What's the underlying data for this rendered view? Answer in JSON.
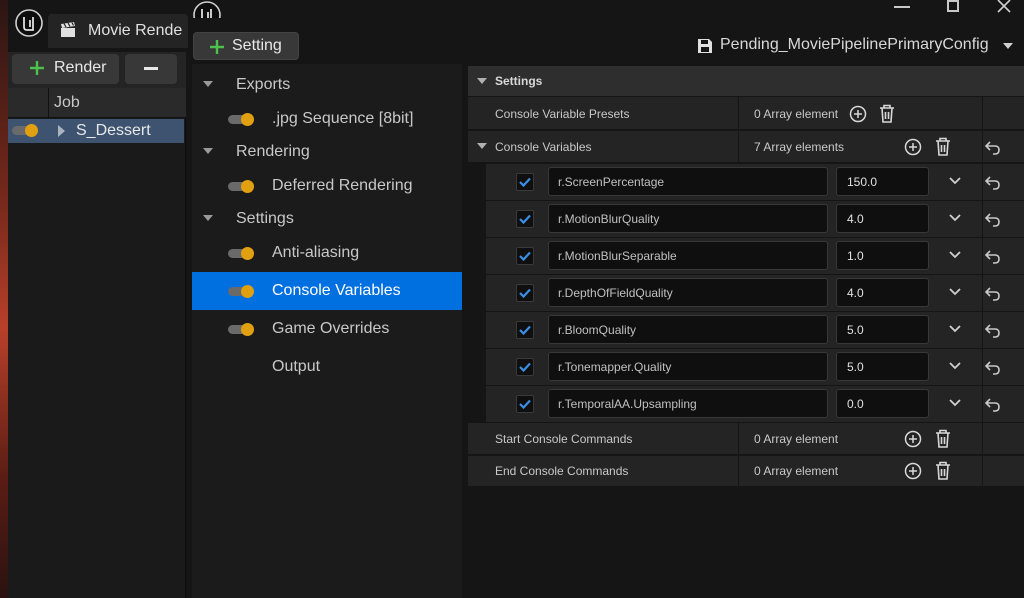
{
  "queue_window": {
    "tab_title": "Movie Rende",
    "toolbar": {
      "render_label": "Render"
    },
    "columns": {
      "job": "Job"
    },
    "jobs": [
      {
        "name": "S_Dessert",
        "enabled": true
      }
    ]
  },
  "config_window": {
    "toolbar": {
      "add_setting_label": "Setting",
      "preset_name": "Pending_MoviePipelinePrimaryConfig"
    },
    "settings_list": [
      {
        "kind": "category",
        "label": "Exports"
      },
      {
        "kind": "item",
        "label": ".jpg Sequence [8bit]",
        "toggle": true
      },
      {
        "kind": "category",
        "label": "Rendering"
      },
      {
        "kind": "item",
        "label": "Deferred Rendering",
        "toggle": true
      },
      {
        "kind": "category",
        "label": "Settings"
      },
      {
        "kind": "item",
        "label": "Anti-aliasing",
        "toggle": true
      },
      {
        "kind": "item",
        "label": "Console Variables",
        "toggle": true,
        "selected": true
      },
      {
        "kind": "item",
        "label": "Game Overrides",
        "toggle": true
      },
      {
        "kind": "item",
        "label": "Output",
        "toggle": false
      }
    ],
    "details": {
      "section_title": "Settings",
      "presets": {
        "label": "Console Variable Presets",
        "value": "0 Array element"
      },
      "console_variables": {
        "label": "Console Variables",
        "value": "7 Array elements",
        "items": [
          {
            "name": "r.ScreenPercentage",
            "value": "150.0",
            "enabled": true
          },
          {
            "name": "r.MotionBlurQuality",
            "value": "4.0",
            "enabled": true
          },
          {
            "name": "r.MotionBlurSeparable",
            "value": "1.0",
            "enabled": true
          },
          {
            "name": "r.DepthOfFieldQuality",
            "value": "4.0",
            "enabled": true
          },
          {
            "name": "r.BloomQuality",
            "value": "5.0",
            "enabled": true
          },
          {
            "name": "r.Tonemapper.Quality",
            "value": "5.0",
            "enabled": true
          },
          {
            "name": "r.TemporalAA.Upsampling",
            "value": "0.0",
            "enabled": true
          }
        ]
      },
      "start_commands": {
        "label": "Start Console Commands",
        "value": "0 Array element"
      },
      "end_commands": {
        "label": "End Console Commands",
        "value": "0 Array element"
      }
    }
  },
  "colors": {
    "accent": "#0070e0",
    "toggle_knob": "#e0a010",
    "plus_green": "#4cc24c",
    "selected_row": "#3e5370"
  },
  "icons": [
    "unreal-logo-icon",
    "clapperboard-icon",
    "plus-icon",
    "minus-icon",
    "save-icon",
    "chevron-down-icon",
    "add-circle-icon",
    "trash-icon",
    "reset-arrow-icon",
    "checkbox-checked-icon",
    "window-minimize-icon",
    "window-maximize-icon",
    "window-close-icon"
  ]
}
